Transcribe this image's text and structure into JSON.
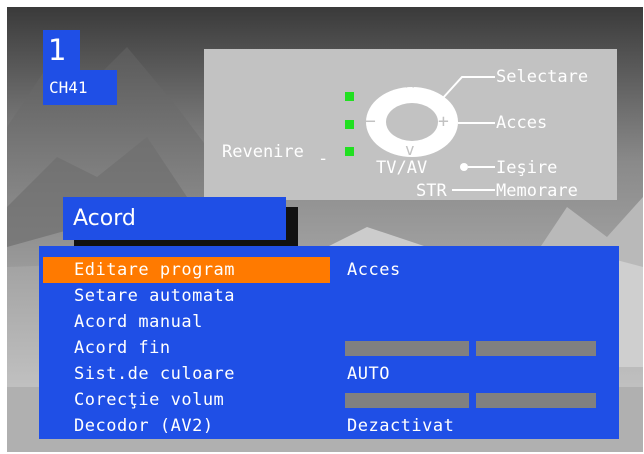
{
  "program": {
    "number": "1",
    "channel": "CH41"
  },
  "legend": {
    "selectare": "Selectare",
    "acces": "Acces",
    "revenire": "Revenire",
    "tvav": "TV/AV",
    "iesire": "Ieşire",
    "str": "STR",
    "memorare": "Memorare",
    "up_symbol": "^",
    "down_symbol": "v",
    "minus_symbol": "−",
    "plus_symbol": "+",
    "led_color": "#21e021"
  },
  "menu": {
    "title": "Acord",
    "items": [
      {
        "label": "Editare program",
        "value": "Acces",
        "selected": true
      },
      {
        "label": "Setare automata",
        "value": ""
      },
      {
        "label": "Acord manual",
        "value": ""
      },
      {
        "label": "Acord fin",
        "value": "",
        "bars": [
          0.5,
          0.5
        ]
      },
      {
        "label": "Sist.de culoare",
        "value": "AUTO"
      },
      {
        "label": "Corecţie volum",
        "value": "",
        "bars": [
          0.5,
          0.5
        ]
      },
      {
        "label": "Decodor (AV2)",
        "value": "Dezactivat"
      }
    ]
  },
  "colors": {
    "osd_blue": "#1f4fe6",
    "highlight": "#ff7a00",
    "legend_bg": "#c2c2c2"
  }
}
